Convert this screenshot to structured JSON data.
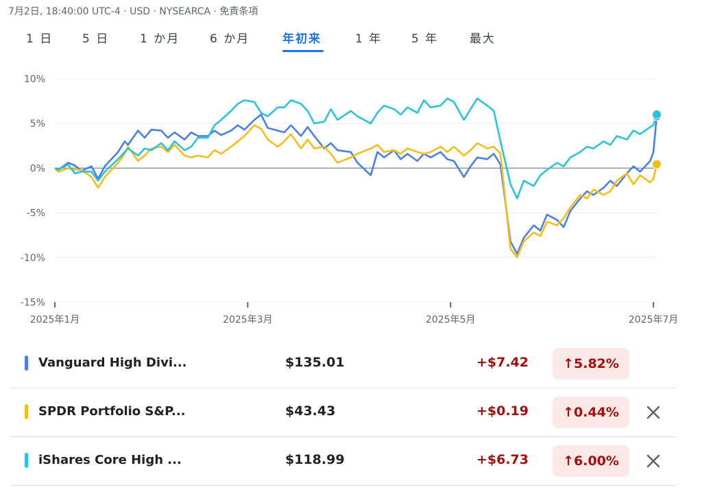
{
  "header": {
    "timestamp": "7月2日, 18:40:00 UTC-4 · USD · NYSEARCA · 免責条項"
  },
  "tabs": [
    {
      "label": "1 日",
      "active": false
    },
    {
      "label": "5 日",
      "active": false
    },
    {
      "label": "1 か月",
      "active": false
    },
    {
      "label": "6 か月",
      "active": false
    },
    {
      "label": "年初来",
      "active": true
    },
    {
      "label": "1 年",
      "active": false
    },
    {
      "label": "5 年",
      "active": false
    },
    {
      "label": "最大",
      "active": false
    }
  ],
  "colors": {
    "blue": "#4a7fe8",
    "yellow": "#f7bc17",
    "cyan": "#27c4dc",
    "accent": "#1a73e8",
    "positive": "#a50e0e"
  },
  "chart_data": {
    "type": "line",
    "ylim": [
      -15,
      10
    ],
    "yticks": [
      10,
      5,
      0,
      -5,
      -10,
      -15
    ],
    "ytick_labels": [
      "10%",
      "5%",
      "0%",
      "-5%",
      "-10%",
      "-15%"
    ],
    "xlim": [
      "2025-01-02",
      "2025-07-02"
    ],
    "xticks": [
      {
        "date": "2025-01-02",
        "label": "2025年1月"
      },
      {
        "date": "2025-03-01",
        "label": "2025年3月"
      },
      {
        "date": "2025-05-01",
        "label": "2025年5月"
      },
      {
        "date": "2025-07-01",
        "label": "2025年7月"
      }
    ],
    "series": [
      {
        "key": "blue",
        "points": [
          [
            "2025-01-02",
            0
          ],
          [
            "2025-01-03",
            -0.2
          ],
          [
            "2025-01-06",
            0.6
          ],
          [
            "2025-01-08",
            0.3
          ],
          [
            "2025-01-10",
            -0.3
          ],
          [
            "2025-01-13",
            0.2
          ],
          [
            "2025-01-15",
            -1.2
          ],
          [
            "2025-01-17",
            0.2
          ],
          [
            "2025-01-21",
            1.8
          ],
          [
            "2025-01-23",
            3.0
          ],
          [
            "2025-01-24",
            2.6
          ],
          [
            "2025-01-27",
            4.2
          ],
          [
            "2025-01-29",
            3.4
          ],
          [
            "2025-01-31",
            4.3
          ],
          [
            "2025-02-03",
            4.2
          ],
          [
            "2025-02-05",
            3.4
          ],
          [
            "2025-02-07",
            4.0
          ],
          [
            "2025-02-10",
            3.2
          ],
          [
            "2025-02-12",
            4.0
          ],
          [
            "2025-02-14",
            3.6
          ],
          [
            "2025-02-17",
            3.6
          ],
          [
            "2025-02-19",
            4.2
          ],
          [
            "2025-02-21",
            3.7
          ],
          [
            "2025-02-24",
            4.2
          ],
          [
            "2025-02-26",
            4.8
          ],
          [
            "2025-02-28",
            4.3
          ],
          [
            "2025-03-03",
            5.4
          ],
          [
            "2025-03-05",
            6.0
          ],
          [
            "2025-03-07",
            4.5
          ],
          [
            "2025-03-10",
            4.2
          ],
          [
            "2025-03-12",
            4.0
          ],
          [
            "2025-03-14",
            4.8
          ],
          [
            "2025-03-17",
            3.6
          ],
          [
            "2025-03-19",
            4.6
          ],
          [
            "2025-03-21",
            3.6
          ],
          [
            "2025-03-24",
            2.2
          ],
          [
            "2025-03-26",
            2.8
          ],
          [
            "2025-03-28",
            2.0
          ],
          [
            "2025-04-01",
            1.8
          ],
          [
            "2025-04-03",
            0.6
          ],
          [
            "2025-04-07",
            -0.8
          ],
          [
            "2025-04-09",
            1.8
          ],
          [
            "2025-04-11",
            1.2
          ],
          [
            "2025-04-14",
            2.0
          ],
          [
            "2025-04-16",
            1.0
          ],
          [
            "2025-04-18",
            1.6
          ],
          [
            "2025-04-21",
            0.8
          ],
          [
            "2025-04-23",
            1.6
          ],
          [
            "2025-04-25",
            1.2
          ],
          [
            "2025-04-28",
            1.8
          ],
          [
            "2025-04-30",
            1.0
          ],
          [
            "2025-05-02",
            0.8
          ],
          [
            "2025-05-05",
            -1.0
          ],
          [
            "2025-05-07",
            0.2
          ],
          [
            "2025-05-09",
            1.2
          ],
          [
            "2025-05-12",
            1.0
          ],
          [
            "2025-05-14",
            1.6
          ],
          [
            "2025-05-16",
            0.4
          ],
          [
            "2025-05-19",
            -8.2
          ],
          [
            "2025-05-21",
            -9.6
          ],
          [
            "2025-05-23",
            -7.8
          ],
          [
            "2025-05-26",
            -6.4
          ],
          [
            "2025-05-28",
            -7.0
          ],
          [
            "2025-05-30",
            -5.2
          ],
          [
            "2025-06-02",
            -5.8
          ],
          [
            "2025-06-04",
            -6.6
          ],
          [
            "2025-06-06",
            -4.8
          ],
          [
            "2025-06-09",
            -3.4
          ],
          [
            "2025-06-11",
            -2.6
          ],
          [
            "2025-06-13",
            -3.0
          ],
          [
            "2025-06-16",
            -2.2
          ],
          [
            "2025-06-18",
            -1.4
          ],
          [
            "2025-06-20",
            -2.0
          ],
          [
            "2025-06-23",
            -0.6
          ],
          [
            "2025-06-25",
            0.2
          ],
          [
            "2025-06-27",
            -0.4
          ],
          [
            "2025-06-30",
            0.8
          ],
          [
            "2025-07-01",
            1.8
          ],
          [
            "2025-07-02",
            5.82
          ]
        ]
      },
      {
        "key": "yellow",
        "points": [
          [
            "2025-01-02",
            0
          ],
          [
            "2025-01-03",
            -0.4
          ],
          [
            "2025-01-06",
            0.0
          ],
          [
            "2025-01-08",
            -0.2
          ],
          [
            "2025-01-10",
            -0.2
          ],
          [
            "2025-01-13",
            -1.0
          ],
          [
            "2025-01-15",
            -2.2
          ],
          [
            "2025-01-17",
            -1.0
          ],
          [
            "2025-01-21",
            0.6
          ],
          [
            "2025-01-23",
            1.6
          ],
          [
            "2025-01-24",
            2.4
          ],
          [
            "2025-01-27",
            0.8
          ],
          [
            "2025-01-29",
            1.4
          ],
          [
            "2025-01-31",
            2.2
          ],
          [
            "2025-02-03",
            2.4
          ],
          [
            "2025-02-05",
            1.8
          ],
          [
            "2025-02-07",
            2.6
          ],
          [
            "2025-02-10",
            1.4
          ],
          [
            "2025-02-12",
            1.2
          ],
          [
            "2025-02-14",
            1.4
          ],
          [
            "2025-02-17",
            1.2
          ],
          [
            "2025-02-19",
            2.0
          ],
          [
            "2025-02-21",
            1.6
          ],
          [
            "2025-02-24",
            2.4
          ],
          [
            "2025-02-26",
            3.0
          ],
          [
            "2025-02-28",
            3.6
          ],
          [
            "2025-03-03",
            4.8
          ],
          [
            "2025-03-05",
            4.4
          ],
          [
            "2025-03-07",
            3.2
          ],
          [
            "2025-03-10",
            2.4
          ],
          [
            "2025-03-12",
            3.0
          ],
          [
            "2025-03-14",
            3.8
          ],
          [
            "2025-03-17",
            2.2
          ],
          [
            "2025-03-19",
            3.2
          ],
          [
            "2025-03-21",
            2.2
          ],
          [
            "2025-03-24",
            2.4
          ],
          [
            "2025-03-26",
            1.6
          ],
          [
            "2025-03-28",
            0.6
          ],
          [
            "2025-04-01",
            1.2
          ],
          [
            "2025-04-03",
            1.6
          ],
          [
            "2025-04-07",
            2.2
          ],
          [
            "2025-04-09",
            2.6
          ],
          [
            "2025-04-11",
            1.8
          ],
          [
            "2025-04-14",
            2.0
          ],
          [
            "2025-04-16",
            1.6
          ],
          [
            "2025-04-18",
            2.2
          ],
          [
            "2025-04-21",
            1.8
          ],
          [
            "2025-04-23",
            1.6
          ],
          [
            "2025-04-25",
            1.8
          ],
          [
            "2025-04-28",
            2.4
          ],
          [
            "2025-04-30",
            1.8
          ],
          [
            "2025-05-02",
            2.4
          ],
          [
            "2025-05-05",
            1.4
          ],
          [
            "2025-05-07",
            2.0
          ],
          [
            "2025-05-09",
            2.8
          ],
          [
            "2025-05-12",
            2.2
          ],
          [
            "2025-05-14",
            2.4
          ],
          [
            "2025-05-16",
            1.6
          ],
          [
            "2025-05-19",
            -9.0
          ],
          [
            "2025-05-21",
            -10.0
          ],
          [
            "2025-05-23",
            -8.2
          ],
          [
            "2025-05-26",
            -7.2
          ],
          [
            "2025-05-28",
            -7.6
          ],
          [
            "2025-05-30",
            -6.0
          ],
          [
            "2025-06-02",
            -6.4
          ],
          [
            "2025-06-04",
            -5.6
          ],
          [
            "2025-06-06",
            -4.4
          ],
          [
            "2025-06-09",
            -3.0
          ],
          [
            "2025-06-11",
            -3.4
          ],
          [
            "2025-06-13",
            -2.4
          ],
          [
            "2025-06-16",
            -3.0
          ],
          [
            "2025-06-18",
            -2.6
          ],
          [
            "2025-06-20",
            -1.4
          ],
          [
            "2025-06-23",
            -0.6
          ],
          [
            "2025-06-25",
            -1.8
          ],
          [
            "2025-06-27",
            -0.8
          ],
          [
            "2025-06-30",
            -1.6
          ],
          [
            "2025-07-01",
            -1.2
          ],
          [
            "2025-07-02",
            0.44
          ]
        ]
      },
      {
        "key": "cyan",
        "points": [
          [
            "2025-01-02",
            0
          ],
          [
            "2025-01-03",
            -0.2
          ],
          [
            "2025-01-06",
            0.4
          ],
          [
            "2025-01-08",
            -0.6
          ],
          [
            "2025-01-10",
            -0.4
          ],
          [
            "2025-01-13",
            -0.4
          ],
          [
            "2025-01-15",
            -1.4
          ],
          [
            "2025-01-17",
            -0.4
          ],
          [
            "2025-01-21",
            1.0
          ],
          [
            "2025-01-23",
            1.8
          ],
          [
            "2025-01-24",
            2.2
          ],
          [
            "2025-01-27",
            1.4
          ],
          [
            "2025-01-29",
            2.2
          ],
          [
            "2025-01-31",
            2.0
          ],
          [
            "2025-02-03",
            2.8
          ],
          [
            "2025-02-05",
            2.0
          ],
          [
            "2025-02-07",
            3.0
          ],
          [
            "2025-02-10",
            2.0
          ],
          [
            "2025-02-12",
            2.4
          ],
          [
            "2025-02-14",
            3.4
          ],
          [
            "2025-02-17",
            3.4
          ],
          [
            "2025-02-19",
            4.8
          ],
          [
            "2025-02-21",
            5.4
          ],
          [
            "2025-02-24",
            6.4
          ],
          [
            "2025-02-26",
            7.2
          ],
          [
            "2025-02-28",
            7.6
          ],
          [
            "2025-03-03",
            7.4
          ],
          [
            "2025-03-05",
            6.2
          ],
          [
            "2025-03-07",
            5.8
          ],
          [
            "2025-03-10",
            6.8
          ],
          [
            "2025-03-12",
            6.8
          ],
          [
            "2025-03-14",
            7.6
          ],
          [
            "2025-03-17",
            7.2
          ],
          [
            "2025-03-19",
            6.4
          ],
          [
            "2025-03-21",
            5.0
          ],
          [
            "2025-03-24",
            5.2
          ],
          [
            "2025-03-26",
            6.6
          ],
          [
            "2025-03-28",
            5.4
          ],
          [
            "2025-04-01",
            6.4
          ],
          [
            "2025-04-03",
            5.8
          ],
          [
            "2025-04-07",
            5.0
          ],
          [
            "2025-04-09",
            6.2
          ],
          [
            "2025-04-11",
            7.0
          ],
          [
            "2025-04-14",
            6.6
          ],
          [
            "2025-04-16",
            6.0
          ],
          [
            "2025-04-18",
            6.8
          ],
          [
            "2025-04-21",
            6.2
          ],
          [
            "2025-04-23",
            7.6
          ],
          [
            "2025-04-25",
            6.8
          ],
          [
            "2025-04-28",
            7.0
          ],
          [
            "2025-04-30",
            7.8
          ],
          [
            "2025-05-02",
            7.4
          ],
          [
            "2025-05-05",
            5.4
          ],
          [
            "2025-05-07",
            6.6
          ],
          [
            "2025-05-09",
            7.8
          ],
          [
            "2025-05-12",
            7.0
          ],
          [
            "2025-05-14",
            6.4
          ],
          [
            "2025-05-16",
            3.0
          ],
          [
            "2025-05-19",
            -1.8
          ],
          [
            "2025-05-21",
            -3.4
          ],
          [
            "2025-05-23",
            -1.4
          ],
          [
            "2025-05-26",
            -2.0
          ],
          [
            "2025-05-28",
            -0.8
          ],
          [
            "2025-05-30",
            -0.2
          ],
          [
            "2025-06-02",
            0.6
          ],
          [
            "2025-06-04",
            0.2
          ],
          [
            "2025-06-06",
            1.2
          ],
          [
            "2025-06-09",
            1.8
          ],
          [
            "2025-06-11",
            2.4
          ],
          [
            "2025-06-13",
            2.2
          ],
          [
            "2025-06-16",
            3.0
          ],
          [
            "2025-06-18",
            2.6
          ],
          [
            "2025-06-20",
            3.6
          ],
          [
            "2025-06-23",
            3.2
          ],
          [
            "2025-06-25",
            4.2
          ],
          [
            "2025-06-27",
            3.8
          ],
          [
            "2025-06-30",
            4.6
          ],
          [
            "2025-07-01",
            4.8
          ],
          [
            "2025-07-02",
            6.0
          ]
        ]
      }
    ]
  },
  "rows": [
    {
      "key": "blue",
      "name": "Vanguard High Divi...",
      "price": "$135.01",
      "change": "+$7.42",
      "pct": "5.82%",
      "removable": false
    },
    {
      "key": "yellow",
      "name": "SPDR Portfolio S&P...",
      "price": "$43.43",
      "change": "+$0.19",
      "pct": "0.44%",
      "removable": true
    },
    {
      "key": "cyan",
      "name": "iShares Core High ...",
      "price": "$118.99",
      "change": "+$6.73",
      "pct": "6.00%",
      "removable": true
    }
  ]
}
